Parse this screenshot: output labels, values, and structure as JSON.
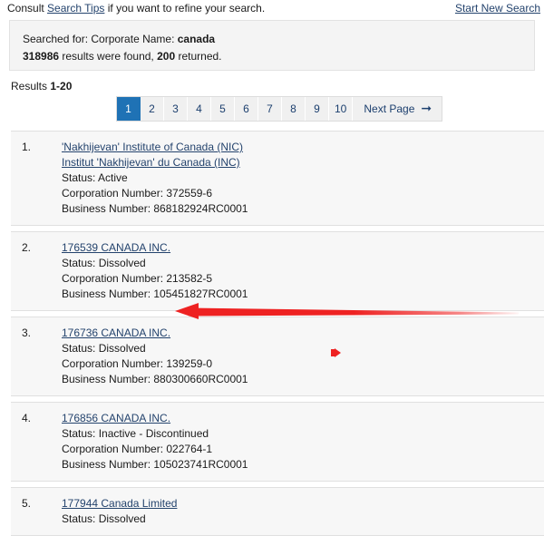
{
  "top_bar": {
    "consult_prefix": "Consult ",
    "search_tips_label": "Search Tips",
    "consult_suffix": " if you want to refine your search.",
    "start_new_search_label": "Start New Search"
  },
  "summary": {
    "searched_for_label": "Searched for: Corporate Name: ",
    "search_term": "canada",
    "results_found_count": "318986",
    "results_found_middle": " results were found, ",
    "returned_count": "200",
    "results_found_suffix": " returned."
  },
  "results_header": {
    "label": "Results ",
    "range": "1-20"
  },
  "pager": {
    "pages": [
      "1",
      "2",
      "3",
      "4",
      "5",
      "6",
      "7",
      "8",
      "9",
      "10"
    ],
    "active_page": "1",
    "next_page_label": "Next Page",
    "next_page_icon": "arrow-right-icon"
  },
  "results": [
    {
      "index": "1.",
      "names": [
        "'Nakhijevan' Institute of Canada (NIC)",
        "Institut 'Nakhijevan' du Canada (INC)"
      ],
      "status": "Status: Active",
      "corporation_number": "Corporation Number: 372559-6",
      "business_number": "Business Number: 868182924RC0001"
    },
    {
      "index": "2.",
      "names": [
        "176539 CANADA INC."
      ],
      "status": "Status: Dissolved",
      "corporation_number": "Corporation Number: 213582-5",
      "business_number": "Business Number: 105451827RC0001"
    },
    {
      "index": "3.",
      "names": [
        "176736 CANADA INC."
      ],
      "status": "Status: Dissolved",
      "corporation_number": "Corporation Number: 139259-0",
      "business_number": "Business Number: 880300660RC0001"
    },
    {
      "index": "4.",
      "names": [
        "176856 CANADA INC."
      ],
      "status": "Status: Inactive - Discontinued",
      "corporation_number": "Corporation Number: 022764-1",
      "business_number": "Business Number: 105023741RC0001"
    },
    {
      "index": "5.",
      "names": [
        "177944 Canada Limited"
      ],
      "status": "Status: Dissolved",
      "corporation_number": "",
      "business_number": ""
    }
  ],
  "annotations": {
    "arrow_color": "#ee2222",
    "marker_color": "#ee2222"
  }
}
